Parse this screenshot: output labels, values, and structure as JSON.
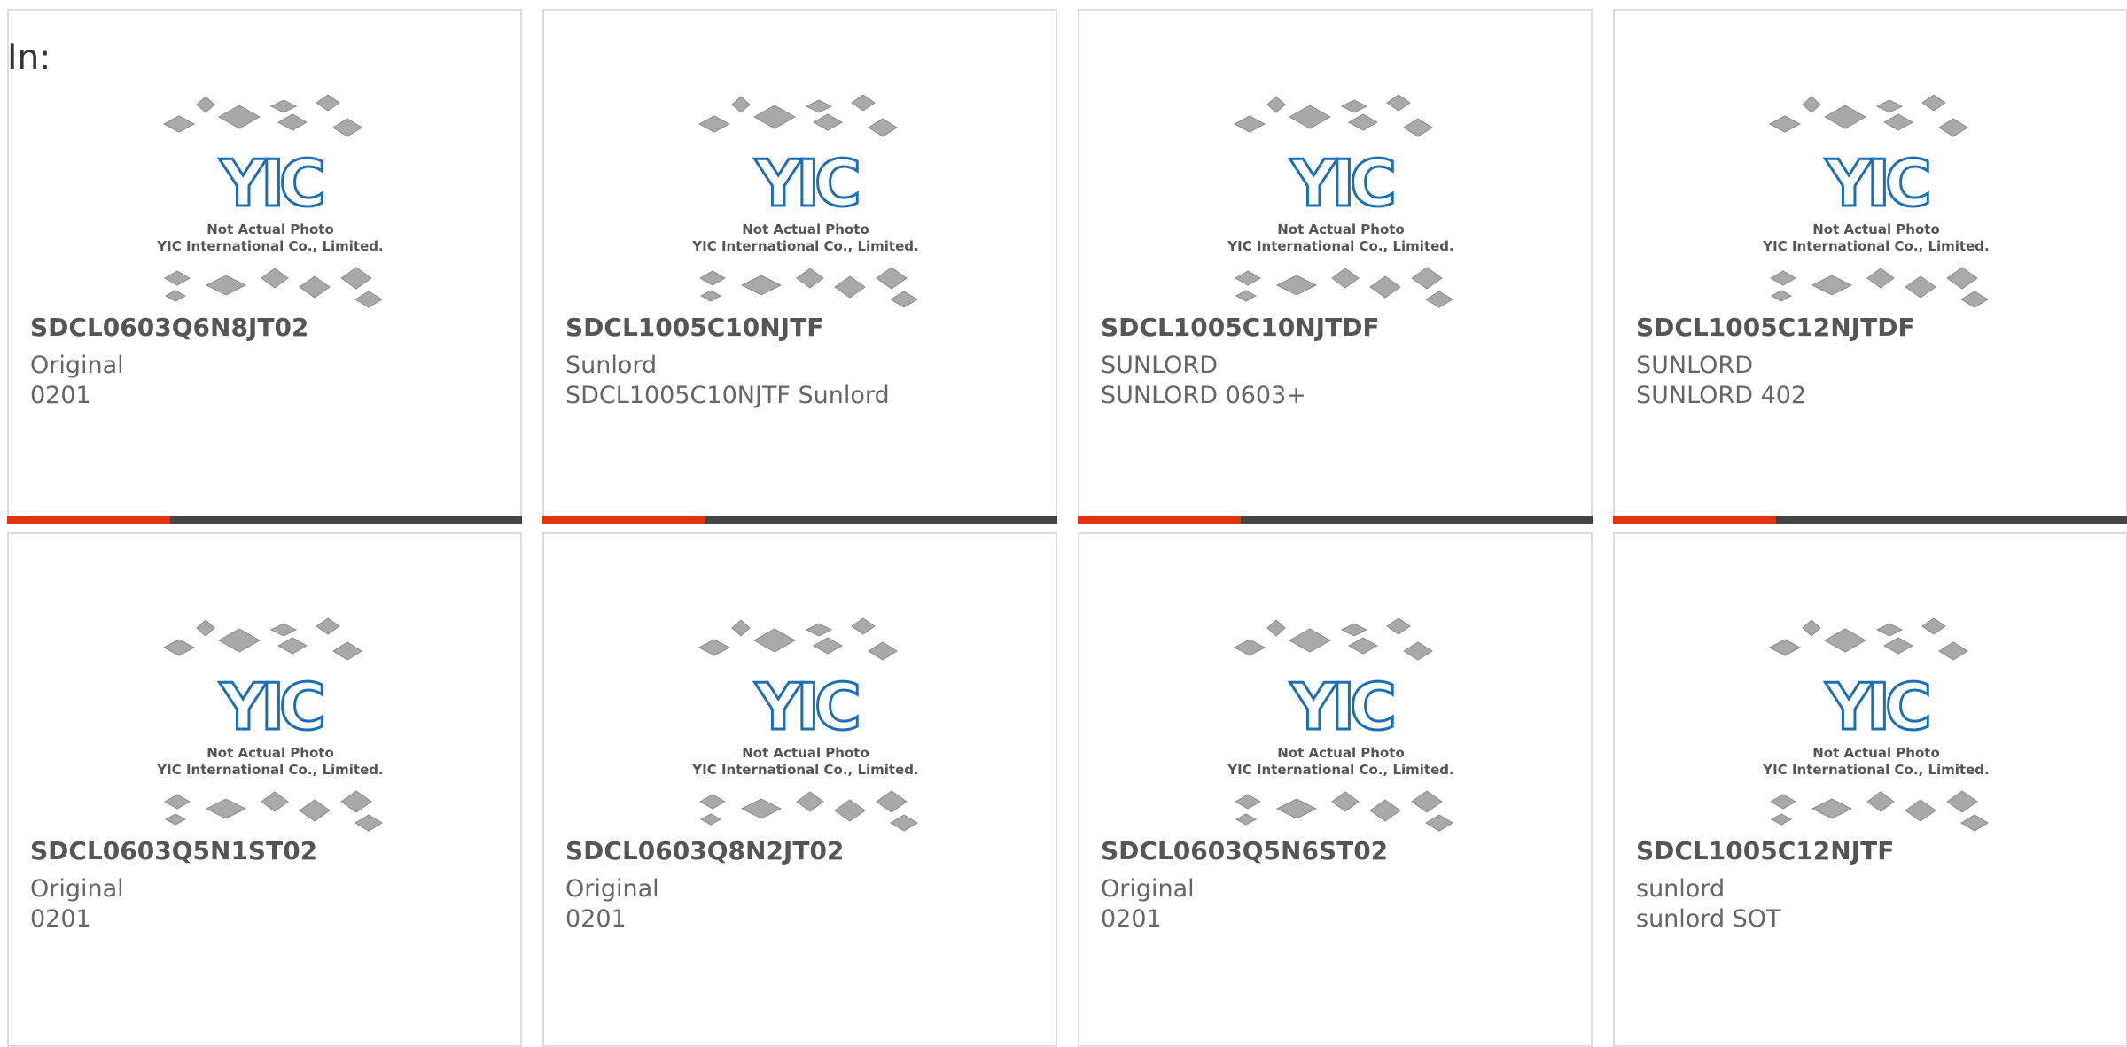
{
  "prefix_label": "In:",
  "thumbnail": {
    "line1": "Not Actual Photo",
    "line2": "YIC International Co., Limited.",
    "logo": "YIC",
    "logo_color": "#1d6fb5",
    "chip_color": "#a9a9a9"
  },
  "accent_color": "#e4330f",
  "bar_color": "#444444",
  "products": [
    {
      "part": "SDCL0603Q6N8JT02",
      "manufacturer": "Original",
      "package": "0201"
    },
    {
      "part": "SDCL1005C10NJTF",
      "manufacturer": "Sunlord",
      "package": "SDCL1005C10NJTF Sunlord"
    },
    {
      "part": "SDCL1005C10NJTDF",
      "manufacturer": "SUNLORD",
      "package": "SUNLORD 0603+"
    },
    {
      "part": "SDCL1005C12NJTDF",
      "manufacturer": "SUNLORD",
      "package": "SUNLORD 402"
    },
    {
      "part": "SDCL0603Q5N1ST02",
      "manufacturer": "Original",
      "package": "0201"
    },
    {
      "part": "SDCL0603Q8N2JT02",
      "manufacturer": "Original",
      "package": "0201"
    },
    {
      "part": "SDCL0603Q5N6ST02",
      "manufacturer": "Original",
      "package": "0201"
    },
    {
      "part": "SDCL1005C12NJTF",
      "manufacturer": "sunlord",
      "package": "sunlord SOT"
    }
  ]
}
